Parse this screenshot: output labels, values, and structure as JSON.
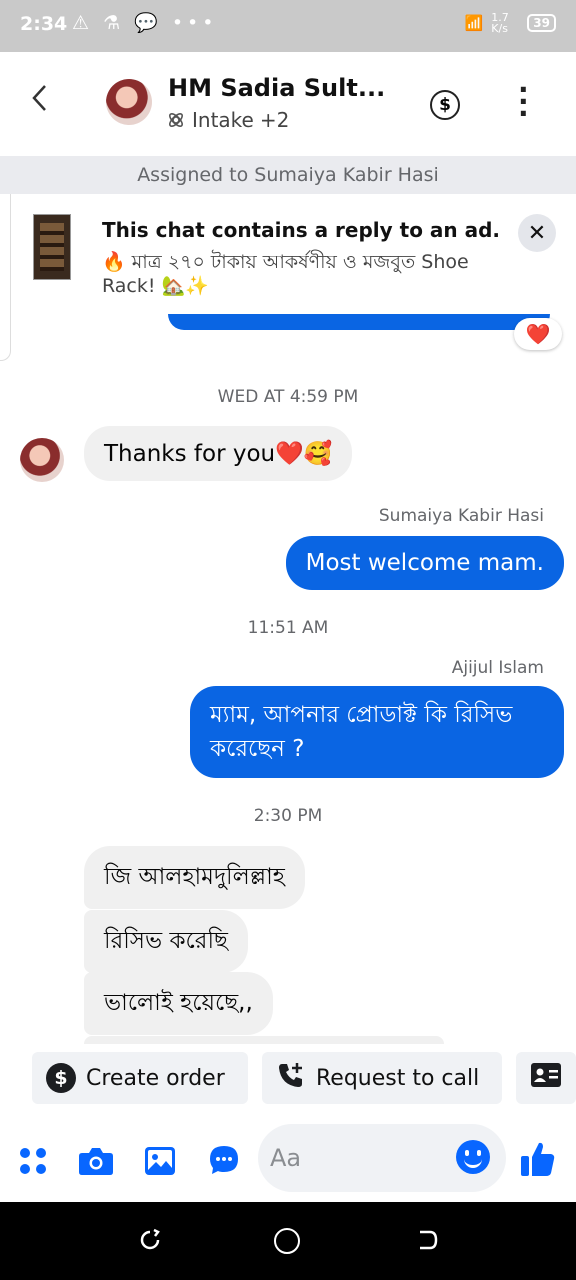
{
  "status": {
    "time": "2:34",
    "left_icons": "⚠ ⚗ 💬 •••",
    "network_speed": "1.7 K/s",
    "battery": "39"
  },
  "header": {
    "name": "HM Sadia Sult...",
    "label": "Intake",
    "label_extra": "+2"
  },
  "assigned": "Assigned to Sumaiya Kabir Hasi",
  "ad": {
    "title": "This chat contains a reply to an ad.",
    "description": "🔥 মাত্র ২৭০ টাকায় আকর্ষণীয় ও মজবুত  Shoe Rack! 🏡✨"
  },
  "reaction": "❤️",
  "messages": {
    "ts1": "WED AT 4:59 PM",
    "in1": "Thanks for you❤️🥰",
    "sender1": "Sumaiya Kabir Hasi",
    "out1": "Most welcome mam.",
    "ts2": "11:51 AM",
    "sender2": "Ajijul Islam",
    "out2": "ম্যাম, আপনার প্রোডাক্ট কি রিসিভ করেছেন ?",
    "ts3": "2:30 PM",
    "in2": "জি আলহামদুলিল্লাহ",
    "in3": "রিসিভ করেছি",
    "in4": "ভালোই হয়েছে,,"
  },
  "actions": {
    "create_order": "Create order",
    "request_call": "Request to call"
  },
  "composer": {
    "placeholder": "Aa"
  },
  "colors": {
    "accent": "#0866ff",
    "outgoing_bubble": "#0a65e3",
    "incoming_bubble": "#f0f0f0"
  }
}
